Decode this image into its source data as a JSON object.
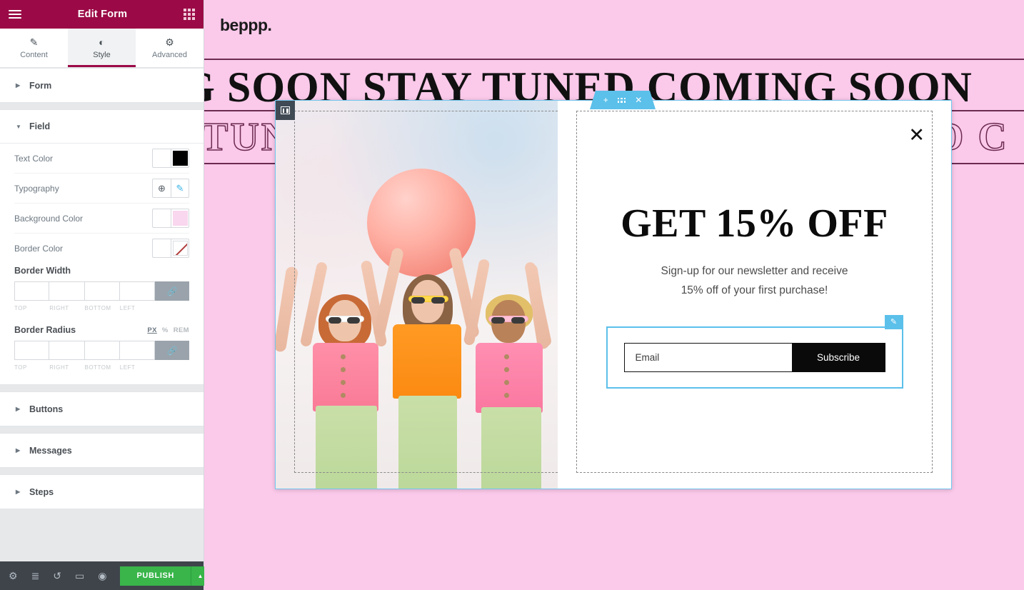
{
  "panel": {
    "header": {
      "title": "Edit Form",
      "menu_icon": "hamburger-icon",
      "widgets_icon": "grid-icon"
    },
    "tabs": [
      {
        "label": "Content",
        "icon": "pencil-icon",
        "glyph": "✎",
        "active": false
      },
      {
        "label": "Style",
        "icon": "contrast-icon",
        "glyph": "◐",
        "active": true
      },
      {
        "label": "Advanced",
        "icon": "gear-icon",
        "glyph": "⚙",
        "active": false
      }
    ],
    "sections": [
      {
        "name": "form",
        "label": "Form",
        "expanded": false,
        "caret": "▶"
      },
      {
        "name": "field",
        "label": "Field",
        "expanded": true,
        "caret": "▼"
      },
      {
        "name": "buttons",
        "label": "Buttons",
        "expanded": false,
        "caret": "▶"
      },
      {
        "name": "messages",
        "label": "Messages",
        "expanded": false,
        "caret": "▶"
      },
      {
        "name": "steps",
        "label": "Steps",
        "expanded": false,
        "caret": "▶"
      }
    ],
    "field_controls": {
      "text_color": {
        "label": "Text Color",
        "value": "#000000"
      },
      "typography": {
        "label": "Typography",
        "globe_glyph": "⊕",
        "pencil_glyph": "✎"
      },
      "background_color": {
        "label": "Background Color",
        "value": "#F9D7EE"
      },
      "border_color": {
        "label": "Border Color",
        "value": "none"
      },
      "border_width": {
        "label": "Border Width",
        "top": "",
        "right": "",
        "bottom": "",
        "left": "",
        "caps": [
          "TOP",
          "RIGHT",
          "BOTTOM",
          "LEFT"
        ],
        "link_glyph": "ὑ7",
        "linked": true
      },
      "border_radius": {
        "label": "Border Radius",
        "top": "",
        "right": "",
        "bottom": "",
        "left": "",
        "caps": [
          "TOP",
          "RIGHT",
          "BOTTOM",
          "LEFT"
        ],
        "units": [
          "PX",
          "%",
          "REM"
        ],
        "active_unit": "PX",
        "linked": true
      }
    },
    "footer": {
      "icons": [
        {
          "name": "settings-icon",
          "glyph": "⚙"
        },
        {
          "name": "navigator-icon",
          "glyph": "≣"
        },
        {
          "name": "history-icon",
          "glyph": "↺"
        },
        {
          "name": "responsive-mode-icon",
          "glyph": "▭"
        },
        {
          "name": "preview-icon",
          "glyph": "◉"
        }
      ],
      "publish_label": "PUBLISH",
      "publish_caret": "▲",
      "publish_color": "#39B54A"
    },
    "header_color": "#9B0A46"
  },
  "canvas": {
    "background_color": "#FBC9EA",
    "logo": "beppp.",
    "marquee_line1": "COMING SOON STAY TUNED COMING SOON",
    "marquee_line2": "STAY TUNED COMING SOON STAY TUNED C",
    "rule_color": "#6B2A50"
  },
  "popup": {
    "toolbar": {
      "add_glyph": "+",
      "drag_icon": "grid-dots-icon",
      "close_glyph": "✕"
    },
    "column_handle_icon": "columns-icon",
    "close_glyph": "✕",
    "headline": "GET 15% OFF",
    "subtitle_line1": "Sign-up for our newsletter and receive",
    "subtitle_line2": "15% off of your first purchase!",
    "form": {
      "email_placeholder": "Email",
      "email_value": "",
      "subscribe_label": "Subscribe",
      "edit_badge_glyph": "✎",
      "highlight_color": "#5BC0EA"
    },
    "image_alt": "three women holding a large pink balloon"
  }
}
